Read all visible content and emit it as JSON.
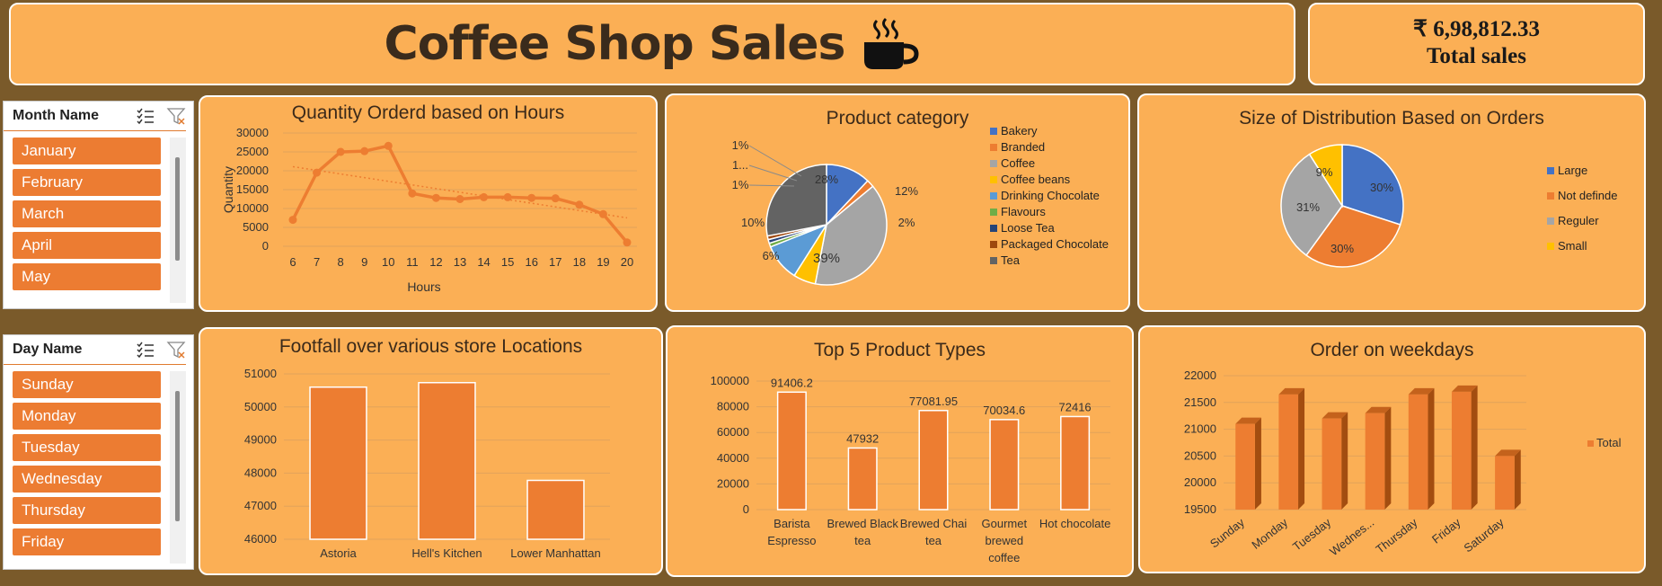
{
  "header": {
    "title": "Coffee Shop Sales",
    "cup_icon": "coffee-cup-icon"
  },
  "kpi": {
    "value": "₹ 6,98,812.33",
    "label": "Total sales"
  },
  "month_slicer": {
    "title": "Month Name",
    "items": [
      "January",
      "February",
      "March",
      "April",
      "May"
    ]
  },
  "day_slicer": {
    "title": "Day Name",
    "items": [
      "Sunday",
      "Monday",
      "Tuesday",
      "Wednesday",
      "Thursday",
      "Friday"
    ]
  },
  "colors": {
    "accent": "#ED7D31",
    "background": "#FBAF55",
    "frame": "#7A5A2A"
  },
  "chart_data": [
    {
      "type": "line",
      "title": "Quantity Orderd based on Hours",
      "xlabel": "Hours",
      "ylabel": "Quantity",
      "x": [
        6,
        7,
        8,
        9,
        10,
        11,
        12,
        13,
        14,
        15,
        16,
        17,
        18,
        19,
        20
      ],
      "values": [
        7000,
        19500,
        25000,
        25200,
        26600,
        14000,
        12800,
        12500,
        13000,
        13000,
        12800,
        12700,
        11000,
        8500,
        1000
      ],
      "yticks": [
        "30000",
        "25000",
        "20000",
        "15000",
        "10000",
        "5000",
        "0"
      ],
      "ylim": [
        0,
        30000
      ],
      "trendline": true
    },
    {
      "type": "pie",
      "title": "Product category",
      "legend": [
        "Bakery",
        "Branded",
        "Coffee",
        "Coffee beans",
        "Drinking Chocolate",
        "Flavours",
        "Loose Tea",
        "Packaged Chocolate",
        "Tea"
      ],
      "values": [
        12,
        2,
        39,
        6,
        10,
        1,
        1,
        1,
        28
      ],
      "labels": [
        "12%",
        "2%",
        "39%",
        "6%",
        "10%",
        "1%",
        "1...",
        "1%",
        "28%"
      ],
      "colors": [
        "#4472C4",
        "#ED7D31",
        "#A5A5A5",
        "#FFC000",
        "#5B9BD5",
        "#70AD47",
        "#264478",
        "#9E480E",
        "#636363"
      ]
    },
    {
      "type": "pie",
      "title": "Size of Distribution Based on Orders",
      "legend": [
        "Large",
        "Not definde",
        "Reguler",
        "Small"
      ],
      "values": [
        30,
        30,
        31,
        9
      ],
      "labels": [
        "30%",
        "30%",
        "31%",
        "9%"
      ],
      "colors": [
        "#4472C4",
        "#ED7D31",
        "#A5A5A5",
        "#FFC000"
      ]
    },
    {
      "type": "bar",
      "title": "Footfall over various store Locations",
      "categories": [
        "Astoria",
        "Hell's Kitchen",
        "Lower Manhattan"
      ],
      "values": [
        50600,
        50735,
        47780
      ],
      "yticks": [
        "51000",
        "50000",
        "49000",
        "48000",
        "47000",
        "46000"
      ],
      "ylim": [
        46000,
        51000
      ]
    },
    {
      "type": "bar",
      "title": "Top 5 Product Types",
      "categories": [
        [
          "Barista",
          "Espresso"
        ],
        [
          "Brewed Black",
          "tea"
        ],
        [
          "Brewed Chai",
          "tea"
        ],
        [
          "Gourmet",
          "brewed",
          "coffee"
        ],
        [
          "Hot chocolate"
        ]
      ],
      "values": [
        91406.2,
        47932,
        77081.95,
        70034.6,
        72416
      ],
      "value_labels": [
        "91406.2",
        "47932",
        "77081.95",
        "70034.6",
        "72416"
      ],
      "yticks": [
        "100000",
        "80000",
        "60000",
        "40000",
        "20000",
        "0"
      ],
      "ylim": [
        0,
        100000
      ]
    },
    {
      "type": "bar",
      "title": "Order on weekdays",
      "categories": [
        "Sunday",
        "Monday",
        "Tuesday",
        "Wednes...",
        "Thursday",
        "Friday",
        "Saturday"
      ],
      "values": [
        21100,
        21650,
        21200,
        21300,
        21650,
        21700,
        20500
      ],
      "yticks": [
        "22000",
        "21500",
        "21000",
        "20500",
        "20000",
        "19500"
      ],
      "ylim": [
        19500,
        22000
      ],
      "legend": [
        "Total"
      ]
    }
  ]
}
